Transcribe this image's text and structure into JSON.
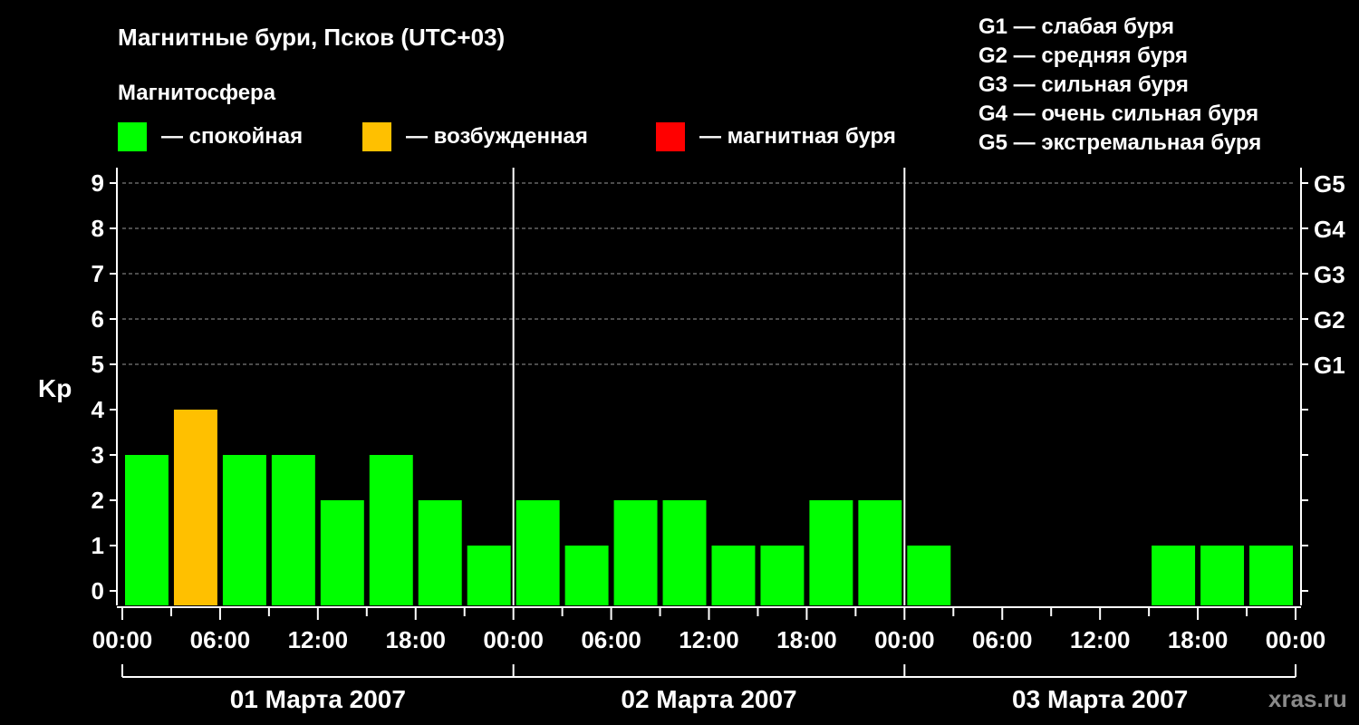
{
  "title": "Магнитные бури, Псков (UTC+03)",
  "legend": {
    "heading": "Магнитосфера",
    "items": [
      {
        "label": "— спокойная",
        "color": "#00ff00"
      },
      {
        "label": "— возбужденная",
        "color": "#ffc000"
      },
      {
        "label": "— магнитная буря",
        "color": "#ff0000"
      }
    ],
    "storm_scale": [
      "G1 — слабая буря",
      "G2 — средняя буря",
      "G3 — сильная буря",
      "G4 — очень сильная буря",
      "G5 — экстремальная буря"
    ]
  },
  "watermark": "xras.ru",
  "chart_data": {
    "type": "bar",
    "ylabel": "Kp",
    "ylim": [
      0,
      9
    ],
    "yticks": [
      0,
      1,
      2,
      3,
      4,
      5,
      6,
      7,
      8,
      9
    ],
    "g_scale": [
      {
        "level": 5,
        "label": "G1"
      },
      {
        "level": 6,
        "label": "G2"
      },
      {
        "level": 7,
        "label": "G3"
      },
      {
        "level": 8,
        "label": "G4"
      },
      {
        "level": 9,
        "label": "G5"
      }
    ],
    "xticks": [
      "00:00",
      "06:00",
      "12:00",
      "18:00",
      "00:00",
      "06:00",
      "12:00",
      "18:00",
      "00:00",
      "06:00",
      "12:00",
      "18:00",
      "00:00"
    ],
    "days": [
      "01 Марта 2007",
      "02 Марта 2007",
      "03 Марта 2007"
    ],
    "interval_hours": 3,
    "values": [
      3,
      4,
      3,
      3,
      2,
      3,
      2,
      1,
      2,
      1,
      2,
      2,
      1,
      1,
      2,
      2,
      1,
      null,
      null,
      null,
      null,
      1,
      1,
      1
    ],
    "colors": {
      "quiet": "#00ff00",
      "active": "#ffc000",
      "storm": "#ff0000",
      "grid": "#999999"
    },
    "grid": true
  }
}
